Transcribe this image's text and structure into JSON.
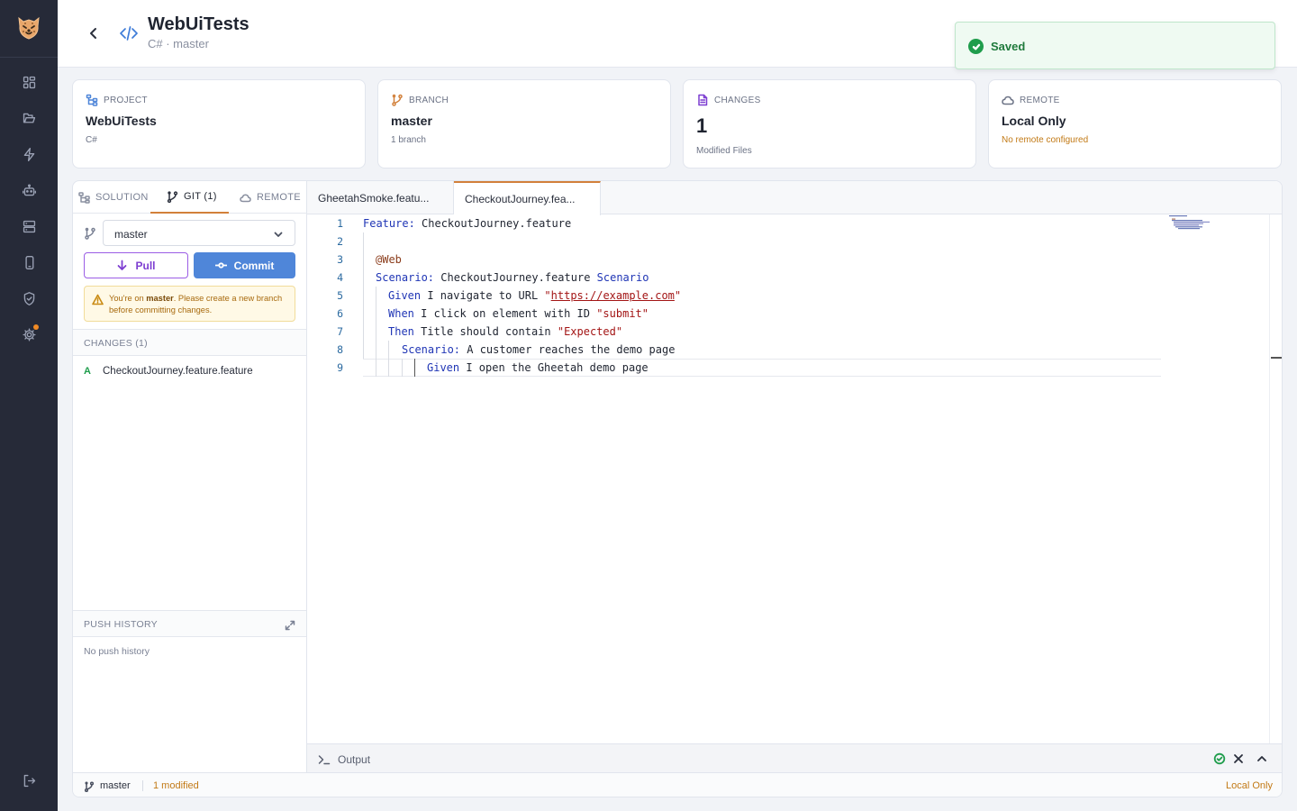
{
  "colors": {
    "accent": "#d2803a",
    "primary": "#4f86d9",
    "success": "#1f9d4c",
    "warning": "#c27a16",
    "rail": "#262a38"
  },
  "header": {
    "title": "WebUiTests",
    "subtitle": "C# · master"
  },
  "toast": {
    "message": "Saved"
  },
  "cards": {
    "project": {
      "label": "PROJECT",
      "value": "WebUiTests",
      "sub": "C#"
    },
    "branch": {
      "label": "BRANCH",
      "value": "master",
      "sub": "1 branch"
    },
    "changes": {
      "label": "CHANGES",
      "value": "1",
      "sub": "Modified Files"
    },
    "remote": {
      "label": "REMOTE",
      "value": "Local Only",
      "sub": "No remote configured"
    }
  },
  "left_tabs": {
    "solution": "SOLUTION",
    "git": "GIT (1)",
    "remote": "REMOTE"
  },
  "git": {
    "branch": "master",
    "pull_label": "Pull",
    "commit_label": "Commit",
    "warning_pre": "You're on ",
    "warning_branch": "master",
    "warning_post": ". Please create a new branch before committing changes.",
    "changes_header": "CHANGES (1)",
    "changes": [
      {
        "status": "A",
        "file": "CheckoutJourney.feature.feature"
      }
    ],
    "push_history_header": "PUSH HISTORY",
    "push_history_empty": "No push history"
  },
  "editor": {
    "tabs": [
      "GheetahSmoke.featu...",
      "CheckoutJourney.fea..."
    ],
    "active_tab": 1,
    "line_numbers": [
      "1",
      "2",
      "3",
      "4",
      "5",
      "6",
      "7",
      "8",
      "9"
    ],
    "lines": {
      "l1": {
        "kw": "Feature:",
        "text": " CheckoutJourney.feature"
      },
      "l3": {
        "tag": "@Web"
      },
      "l4": {
        "kw": "Scenario:",
        "text": " CheckoutJourney.feature ",
        "kw2": "Scenario"
      },
      "l5": {
        "kw": "Given",
        "text": " I navigate to URL ",
        "q1": "\"",
        "url": "https://example.com",
        "q2": "\""
      },
      "l6": {
        "kw": "When",
        "text": " I click on element with ID ",
        "str": "\"submit\""
      },
      "l7": {
        "kw": "Then",
        "text": " Title should contain ",
        "str": "\"Expected\""
      },
      "l8": {
        "kw": "Scenario:",
        "text": " A customer reaches the demo page"
      },
      "l9": {
        "kw": "Given",
        "text": " I open the Gheetah demo page"
      }
    }
  },
  "output": {
    "label": "Output"
  },
  "statusbar": {
    "branch": "master",
    "modified": "1 modified",
    "remote": "Local Only"
  }
}
